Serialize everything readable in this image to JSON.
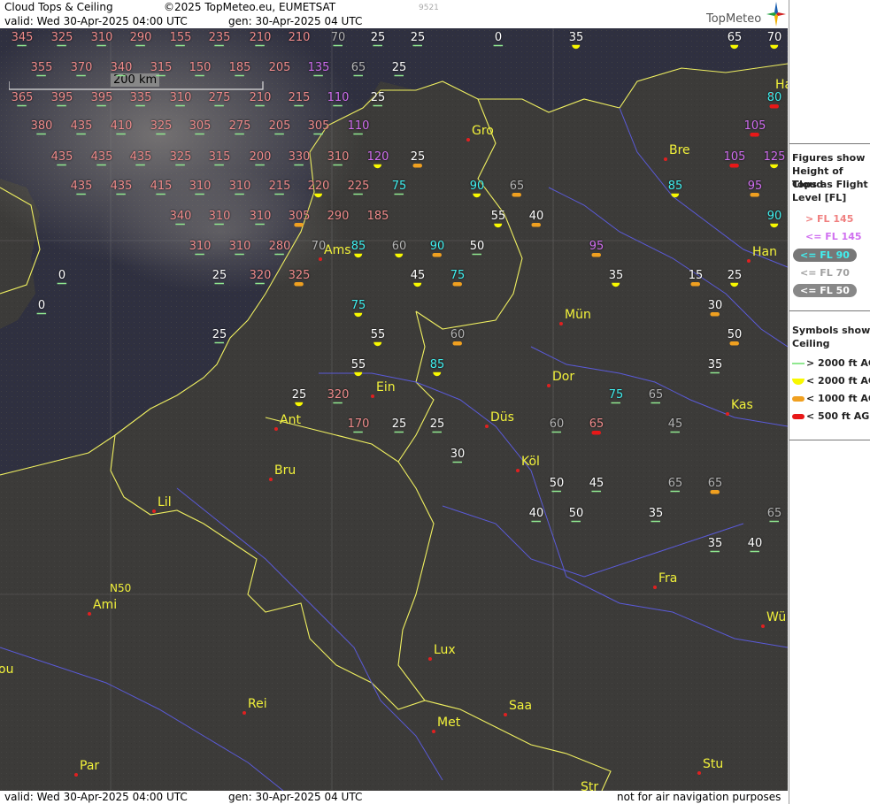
{
  "header": {
    "title": "Cloud Tops & Ceiling",
    "copyright": "©2025 TopMeteo.eu, EUMETSAT",
    "valid": "valid:  Wed  30-Apr-2025  04:00 UTC",
    "gen": "gen: 30-Apr-2025 04 UTC",
    "stamp": "9521",
    "logo": "TopMeteo",
    "logo_icon": "compass-star-icon"
  },
  "footer": {
    "valid": "valid:  Wed  30-Apr-2025  04:00 UTC",
    "gen": "gen: 30-Apr-2025 04 UTC",
    "disclaimer": "not for air navigation purposes"
  },
  "scale_label": "200 km",
  "graticule_label": "N50",
  "legend": {
    "title1": "Figures show",
    "title2": "Height of Cloud",
    "title3": "Tops as Flight",
    "title4": "Level  [FL]",
    "fl_items": [
      {
        "label": "> FL 145",
        "color": "#f08080"
      },
      {
        "label": "<= FL 145",
        "color": "#d070f0"
      },
      {
        "label": "<= FL 90",
        "color": "#40f0f0"
      },
      {
        "label": "<= FL 70",
        "color": "#a0a0a0"
      },
      {
        "label": "<= FL 50",
        "color": "#ffffff"
      }
    ],
    "ceiling_title1": "Symbols show",
    "ceiling_title2": "Ceiling",
    "ceiling_items": [
      {
        "label": "> 2000 ft AGL",
        "symbol": "line",
        "color": "#90e890"
      },
      {
        "label": "< 2000 ft AGL",
        "symbol": "half-disc",
        "color": "#f8f800"
      },
      {
        "label": "< 1000 ft AGL",
        "symbol": "bar",
        "color": "#f0a020"
      },
      {
        "label": "< 500 ft AGL",
        "symbol": "bar",
        "color": "#e81818"
      }
    ]
  },
  "colors": {
    "land": "#3c3b39",
    "sea": "#2f3040",
    "border": "#f0f060",
    "river": "#5a5ad8",
    "city": "#f2f23a"
  },
  "cities": [
    {
      "name": "Gro"
    },
    {
      "name": "Bre"
    },
    {
      "name": "Ha"
    },
    {
      "name": "Han"
    },
    {
      "name": "Ams"
    },
    {
      "name": "Mün"
    },
    {
      "name": "Dor"
    },
    {
      "name": "Ein"
    },
    {
      "name": "Düs"
    },
    {
      "name": "Kas"
    },
    {
      "name": "Ant"
    },
    {
      "name": "Bru"
    },
    {
      "name": "Köl"
    },
    {
      "name": "Lil"
    },
    {
      "name": "Ami"
    },
    {
      "name": "Fra"
    },
    {
      "name": "Wü"
    },
    {
      "name": "Lux"
    },
    {
      "name": "ou"
    },
    {
      "name": "Rei"
    },
    {
      "name": "Saa"
    },
    {
      "name": "Met"
    },
    {
      "name": "Stu"
    },
    {
      "name": "Par"
    },
    {
      "name": "Str"
    }
  ],
  "markers": [
    {
      "v": "345",
      "c": "r",
      "s": "g"
    },
    {
      "v": "325",
      "c": "r",
      "s": "g"
    },
    {
      "v": "310",
      "c": "r",
      "s": "g"
    },
    {
      "v": "290",
      "c": "r",
      "s": "g"
    },
    {
      "v": "155",
      "c": "r",
      "s": "g"
    },
    {
      "v": "235",
      "c": "r",
      "s": "g"
    },
    {
      "v": "210",
      "c": "r",
      "s": "g"
    },
    {
      "v": "210",
      "c": "r",
      "s": ""
    },
    {
      "v": "70",
      "c": "a",
      "s": "g"
    },
    {
      "v": "25",
      "c": "w",
      "s": "g"
    },
    {
      "v": "25",
      "c": "w",
      "s": "g"
    },
    {
      "v": "0",
      "c": "w",
      "s": "g"
    },
    {
      "v": "35",
      "c": "w",
      "s": "y"
    },
    {
      "v": "65",
      "c": "w",
      "s": "y"
    },
    {
      "v": "70",
      "c": "w",
      "s": "y"
    },
    {
      "v": "355",
      "c": "r",
      "s": "g"
    },
    {
      "v": "370",
      "c": "r",
      "s": "g"
    },
    {
      "v": "340",
      "c": "r",
      "s": "g"
    },
    {
      "v": "315",
      "c": "r",
      "s": "g"
    },
    {
      "v": "150",
      "c": "r",
      "s": "g"
    },
    {
      "v": "185",
      "c": "r",
      "s": "g"
    },
    {
      "v": "205",
      "c": "r",
      "s": ""
    },
    {
      "v": "135",
      "c": "p",
      "s": "g"
    },
    {
      "v": "65",
      "c": "a",
      "s": "g"
    },
    {
      "v": "25",
      "c": "w",
      "s": "g"
    },
    {
      "v": "365",
      "c": "r",
      "s": "g"
    },
    {
      "v": "395",
      "c": "r",
      "s": "g"
    },
    {
      "v": "395",
      "c": "r",
      "s": "g"
    },
    {
      "v": "335",
      "c": "r",
      "s": "g"
    },
    {
      "v": "310",
      "c": "r",
      "s": "g"
    },
    {
      "v": "275",
      "c": "r",
      "s": "g"
    },
    {
      "v": "210",
      "c": "r",
      "s": "g"
    },
    {
      "v": "215",
      "c": "r",
      "s": "g"
    },
    {
      "v": "110",
      "c": "p",
      "s": "g"
    },
    {
      "v": "25",
      "c": "w",
      "s": "g"
    },
    {
      "v": "80",
      "c": "c",
      "s": "rd"
    },
    {
      "v": "380",
      "c": "r",
      "s": "g"
    },
    {
      "v": "435",
      "c": "r",
      "s": "g"
    },
    {
      "v": "410",
      "c": "r",
      "s": "g"
    },
    {
      "v": "325",
      "c": "r",
      "s": "g"
    },
    {
      "v": "305",
      "c": "r",
      "s": "g"
    },
    {
      "v": "275",
      "c": "r",
      "s": "g"
    },
    {
      "v": "205",
      "c": "r",
      "s": "g"
    },
    {
      "v": "305",
      "c": "r",
      "s": "g"
    },
    {
      "v": "110",
      "c": "p",
      "s": "g"
    },
    {
      "v": "105",
      "c": "p",
      "s": "rd"
    },
    {
      "v": "435",
      "c": "r",
      "s": "g"
    },
    {
      "v": "435",
      "c": "r",
      "s": "g"
    },
    {
      "v": "435",
      "c": "r",
      "s": "g"
    },
    {
      "v": "325",
      "c": "r",
      "s": "g"
    },
    {
      "v": "315",
      "c": "r",
      "s": "g"
    },
    {
      "v": "200",
      "c": "r",
      "s": "g"
    },
    {
      "v": "330",
      "c": "r",
      "s": "g"
    },
    {
      "v": "310",
      "c": "r",
      "s": "g"
    },
    {
      "v": "120",
      "c": "p",
      "s": "y"
    },
    {
      "v": "25",
      "c": "w",
      "s": "o"
    },
    {
      "v": "105",
      "c": "p",
      "s": "rd"
    },
    {
      "v": "125",
      "c": "p",
      "s": "y"
    },
    {
      "v": "435",
      "c": "r",
      "s": "g"
    },
    {
      "v": "435",
      "c": "r",
      "s": "g"
    },
    {
      "v": "415",
      "c": "r",
      "s": "g"
    },
    {
      "v": "310",
      "c": "r",
      "s": "g"
    },
    {
      "v": "310",
      "c": "r",
      "s": "g"
    },
    {
      "v": "215",
      "c": "r",
      "s": "g"
    },
    {
      "v": "220",
      "c": "r",
      "s": "y"
    },
    {
      "v": "225",
      "c": "r",
      "s": "g"
    },
    {
      "v": "75",
      "c": "c",
      "s": "g"
    },
    {
      "v": "90",
      "c": "c",
      "s": "y"
    },
    {
      "v": "65",
      "c": "a",
      "s": "o"
    },
    {
      "v": "85",
      "c": "c",
      "s": "y"
    },
    {
      "v": "95",
      "c": "p",
      "s": "o"
    },
    {
      "v": "340",
      "c": "r",
      "s": "g"
    },
    {
      "v": "310",
      "c": "r",
      "s": "g"
    },
    {
      "v": "310",
      "c": "r",
      "s": "g"
    },
    {
      "v": "305",
      "c": "r",
      "s": "o"
    },
    {
      "v": "290",
      "c": "r",
      "s": ""
    },
    {
      "v": "185",
      "c": "r",
      "s": ""
    },
    {
      "v": "55",
      "c": "w",
      "s": "y"
    },
    {
      "v": "40",
      "c": "w",
      "s": "o"
    },
    {
      "v": "90",
      "c": "c",
      "s": "y"
    },
    {
      "v": "310",
      "c": "r",
      "s": "g"
    },
    {
      "v": "310",
      "c": "r",
      "s": "g"
    },
    {
      "v": "280",
      "c": "r",
      "s": "g"
    },
    {
      "v": "70",
      "c": "a",
      "s": ""
    },
    {
      "v": "85",
      "c": "c",
      "s": "y"
    },
    {
      "v": "60",
      "c": "a",
      "s": "y"
    },
    {
      "v": "90",
      "c": "c",
      "s": "o"
    },
    {
      "v": "50",
      "c": "w",
      "s": "g"
    },
    {
      "v": "95",
      "c": "p",
      "s": "o"
    },
    {
      "v": "0",
      "c": "w",
      "s": "g"
    },
    {
      "v": "25",
      "c": "w",
      "s": "g"
    },
    {
      "v": "320",
      "c": "r",
      "s": "g"
    },
    {
      "v": "325",
      "c": "r",
      "s": "o"
    },
    {
      "v": "45",
      "c": "w",
      "s": "y"
    },
    {
      "v": "75",
      "c": "c",
      "s": "o"
    },
    {
      "v": "35",
      "c": "w",
      "s": "y"
    },
    {
      "v": "15",
      "c": "w",
      "s": "o"
    },
    {
      "v": "25",
      "c": "w",
      "s": "y"
    },
    {
      "v": "0",
      "c": "w",
      "s": "g"
    },
    {
      "v": "75",
      "c": "c",
      "s": "y"
    },
    {
      "v": "30",
      "c": "w",
      "s": "o"
    },
    {
      "v": "25",
      "c": "w",
      "s": "g"
    },
    {
      "v": "55",
      "c": "w",
      "s": "y"
    },
    {
      "v": "60",
      "c": "a",
      "s": "o"
    },
    {
      "v": "50",
      "c": "w",
      "s": "o"
    },
    {
      "v": "55",
      "c": "w",
      "s": "y"
    },
    {
      "v": "85",
      "c": "c",
      "s": "y"
    },
    {
      "v": "35",
      "c": "w",
      "s": "g"
    },
    {
      "v": "25",
      "c": "w",
      "s": "y"
    },
    {
      "v": "320",
      "c": "r",
      "s": "g"
    },
    {
      "v": "75",
      "c": "c",
      "s": "g"
    },
    {
      "v": "65",
      "c": "a",
      "s": "g"
    },
    {
      "v": "170",
      "c": "r",
      "s": "g"
    },
    {
      "v": "25",
      "c": "w",
      "s": "g"
    },
    {
      "v": "25",
      "c": "w",
      "s": "g"
    },
    {
      "v": "60",
      "c": "a",
      "s": "g"
    },
    {
      "v": "65",
      "c": "r",
      "s": "rd"
    },
    {
      "v": "45",
      "c": "a",
      "s": "g"
    },
    {
      "v": "30",
      "c": "w",
      "s": "g"
    },
    {
      "v": "50",
      "c": "w",
      "s": "g"
    },
    {
      "v": "45",
      "c": "w",
      "s": "g"
    },
    {
      "v": "65",
      "c": "a",
      "s": "g"
    },
    {
      "v": "65",
      "c": "a",
      "s": "o"
    },
    {
      "v": "40",
      "c": "w",
      "s": "g"
    },
    {
      "v": "50",
      "c": "w",
      "s": "g"
    },
    {
      "v": "35",
      "c": "w",
      "s": "g"
    },
    {
      "v": "65",
      "c": "a",
      "s": "g"
    },
    {
      "v": "35",
      "c": "w",
      "s": "g"
    },
    {
      "v": "40",
      "c": "w",
      "s": "g"
    }
  ]
}
